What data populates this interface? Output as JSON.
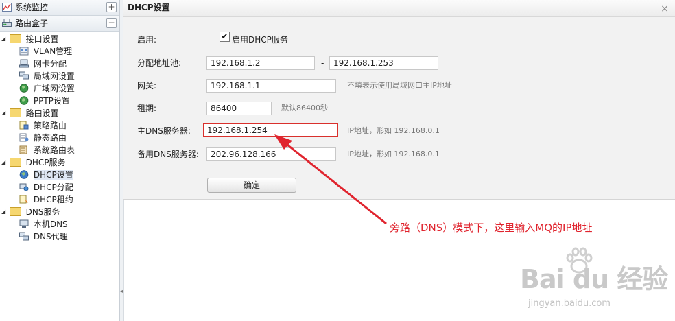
{
  "sidebar": {
    "sections": [
      {
        "title": "系统监控",
        "toggle": "+"
      },
      {
        "title": "路由盒子",
        "toggle": "−"
      }
    ],
    "tree": [
      {
        "label": "接口设置",
        "level": 0,
        "kind": "group",
        "icon": "folder-icon",
        "expander": "◢"
      },
      {
        "label": "VLAN管理",
        "level": 1,
        "icon": "vlan-icon"
      },
      {
        "label": "网卡分配",
        "level": 1,
        "icon": "nic-icon"
      },
      {
        "label": "局域网设置",
        "level": 1,
        "icon": "lan-icon"
      },
      {
        "label": "广域网设置",
        "level": 1,
        "icon": "wan-globe-icon"
      },
      {
        "label": "PPTP设置",
        "level": 1,
        "icon": "pptp-globe-icon"
      },
      {
        "label": "路由设置",
        "level": 0,
        "kind": "group",
        "icon": "folder-icon",
        "expander": "◢"
      },
      {
        "label": "策略路由",
        "level": 1,
        "icon": "policy-route-icon"
      },
      {
        "label": "静态路由",
        "level": 1,
        "icon": "static-route-icon"
      },
      {
        "label": "系统路由表",
        "level": 1,
        "icon": "route-table-icon"
      },
      {
        "label": "DHCP服务",
        "level": 0,
        "kind": "group",
        "icon": "folder-icon",
        "expander": "◢"
      },
      {
        "label": "DHCP设置",
        "level": 1,
        "icon": "dhcp-globe-icon",
        "selected": true
      },
      {
        "label": "DHCP分配",
        "level": 1,
        "icon": "dhcp-assign-icon"
      },
      {
        "label": "DHCP租约",
        "level": 1,
        "icon": "dhcp-lease-icon"
      },
      {
        "label": "DNS服务",
        "level": 0,
        "kind": "group",
        "icon": "folder-icon",
        "expander": "◢"
      },
      {
        "label": "本机DNS",
        "level": 1,
        "icon": "local-dns-icon"
      },
      {
        "label": "DNS代理",
        "level": 1,
        "icon": "dns-proxy-icon"
      }
    ]
  },
  "dialog": {
    "title": "DHCP设置",
    "close": "×",
    "enable": {
      "label": "启用:",
      "checked": true,
      "check_mark": "✔",
      "checkbox_label": "启用DHCP服务"
    },
    "pool": {
      "label": "分配地址池:",
      "start": "192.168.1.2",
      "separator": "-",
      "end": "192.168.1.253"
    },
    "gateway": {
      "label": "网关:",
      "value": "192.168.1.1",
      "hint": "不填表示使用局域网口主IP地址"
    },
    "lease": {
      "label": "租期:",
      "value": "86400",
      "hint": "默认86400秒"
    },
    "primary_dns": {
      "label": "主DNS服务器:",
      "value": "192.168.1.254",
      "hint": "IP地址，形如 192.168.0.1"
    },
    "secondary_dns": {
      "label": "备用DNS服务器:",
      "value": "202.96.128.166",
      "hint": "IP地址，形如 192.168.0.1"
    },
    "confirm_label": "确定"
  },
  "annotation": {
    "text": "旁路（DNS）模式下，这里输入MQ的IP地址",
    "color": "#e0242e"
  },
  "watermark": {
    "logo": "Bai du 经验",
    "url": "jingyan.baidu.com"
  },
  "colors": {
    "accent_red": "#d9302c",
    "selected_bg": "#dfe8f5",
    "folder": "#f6d770"
  }
}
